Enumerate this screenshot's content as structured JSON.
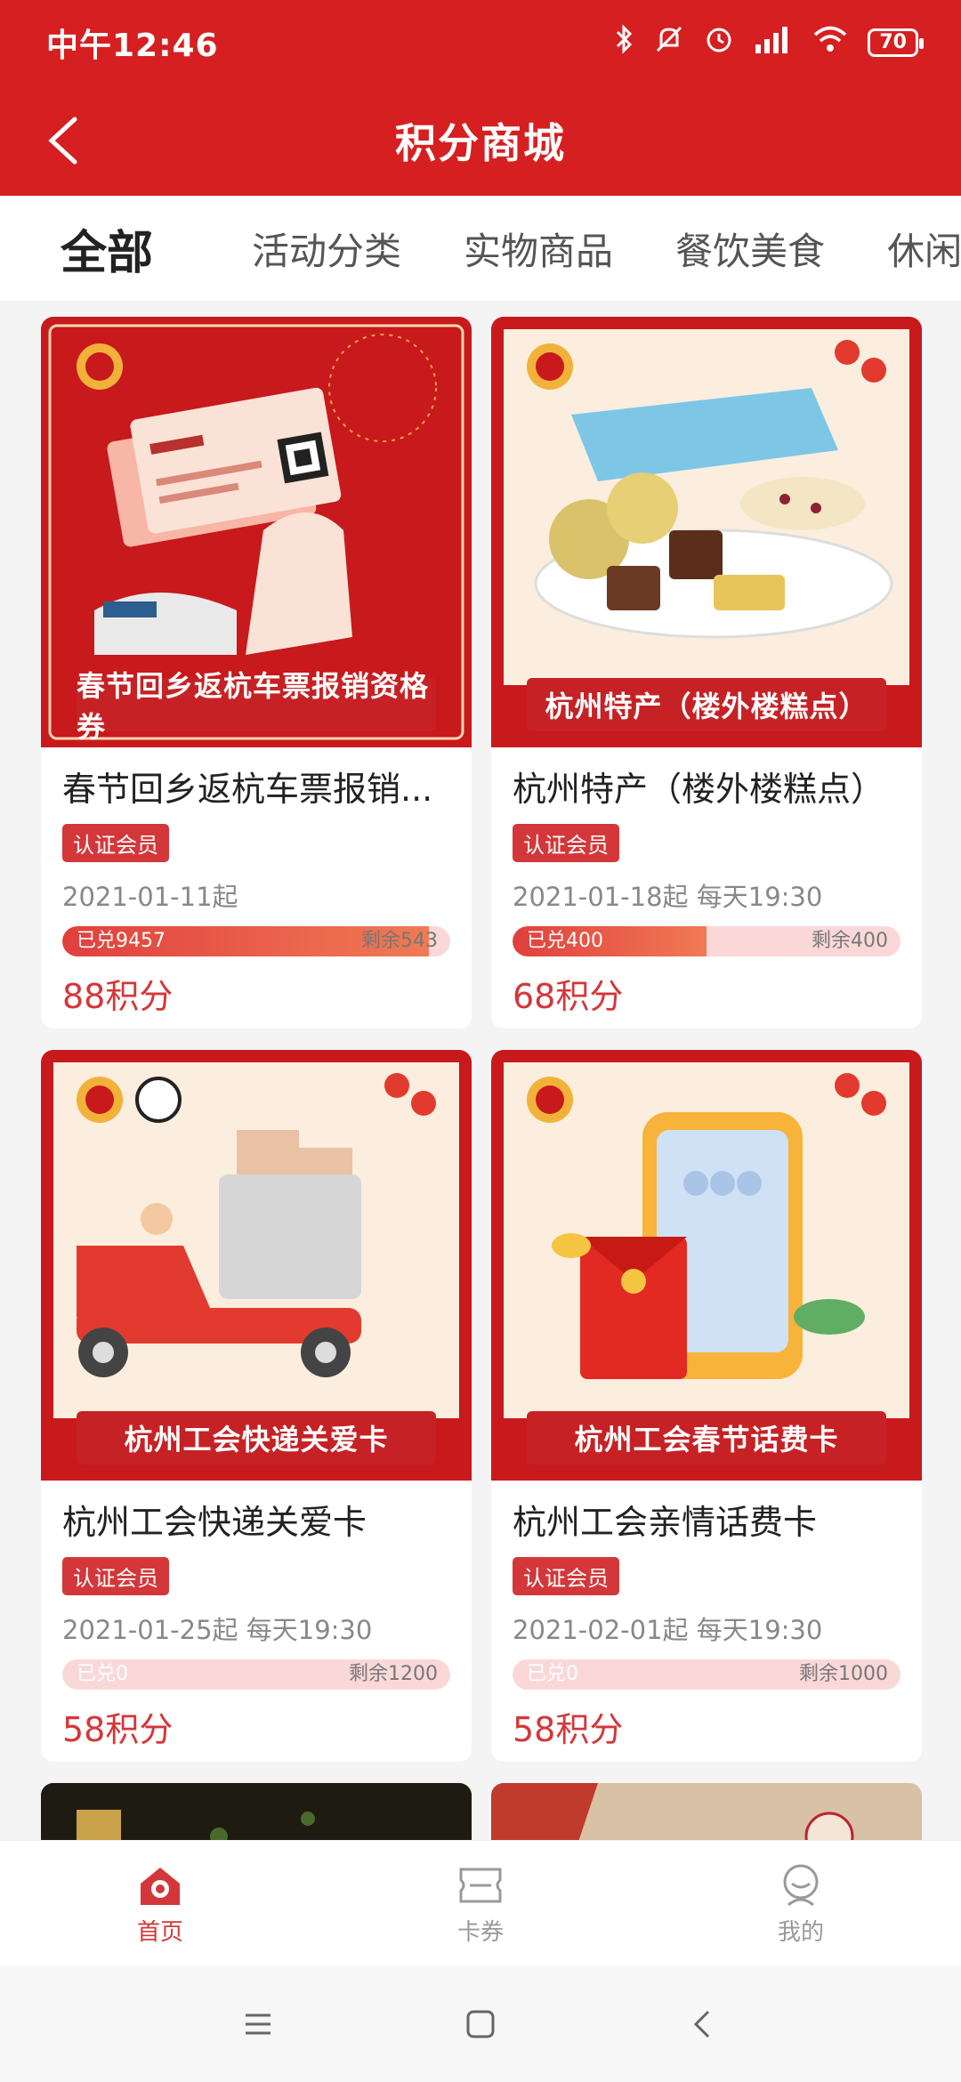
{
  "status_bar": {
    "time": "中午12:46",
    "battery": "70"
  },
  "header": {
    "title": "积分商城"
  },
  "tabs": [
    {
      "label": "全部",
      "active": true
    },
    {
      "label": "活动分类",
      "active": false
    },
    {
      "label": "实物商品",
      "active": false
    },
    {
      "label": "餐饮美食",
      "active": false
    },
    {
      "label": "休闲",
      "active": false
    }
  ],
  "products": [
    {
      "poster_caption": "春节回乡返杭车票报销资格券",
      "name": "春节回乡返杭车票报销...",
      "badge": "认证会员",
      "date": "2021-01-11起",
      "redeemed": "已兑9457",
      "remaining": "剩余543",
      "progress": 0.946,
      "points": "88积分"
    },
    {
      "poster_caption": "杭州特产（楼外楼糕点）",
      "name": "杭州特产（楼外楼糕点）",
      "badge": "认证会员",
      "date": "2021-01-18起 每天19:30",
      "redeemed": "已兑400",
      "remaining": "剩余400",
      "progress": 0.5,
      "points": "68积分"
    },
    {
      "poster_caption": "杭州工会快递关爱卡",
      "name": "杭州工会快递关爱卡",
      "badge": "认证会员",
      "date": "2021-01-25起 每天19:30",
      "redeemed": "已兑0",
      "remaining": "剩余1200",
      "progress": 0,
      "points": "58积分"
    },
    {
      "poster_caption": "杭州工会春节话费卡",
      "name": "杭州工会亲情话费卡",
      "badge": "认证会员",
      "date": "2021-02-01起 每天19:30",
      "redeemed": "已兑0",
      "remaining": "剩余1000",
      "progress": 0,
      "points": "58积分"
    }
  ],
  "bottom_nav": [
    {
      "label": "首页",
      "icon": "home-icon",
      "active": true
    },
    {
      "label": "卡券",
      "icon": "coupon-icon",
      "active": false
    },
    {
      "label": "我的",
      "icon": "profile-icon",
      "active": false
    }
  ],
  "colors": {
    "primary": "#d61f21",
    "accent": "#d4373a",
    "progress_bg": "#fbd8d8"
  }
}
